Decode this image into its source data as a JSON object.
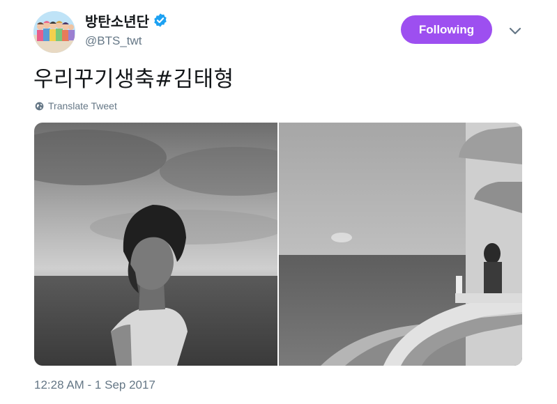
{
  "user": {
    "display_name": "방탄소년단",
    "handle": "@BTS_twt",
    "verified_icon": "verified-badge-icon",
    "avatar_icon": "avatar"
  },
  "follow_button": {
    "label": "Following",
    "color": "#9d4ff0"
  },
  "menu_icon": "chevron-down-icon",
  "tweet": {
    "text": "우리꾸기생축#김태형",
    "translate_label": "Translate Tweet",
    "translate_icon": "globe-icon",
    "timestamp": "12:28 AM - 1 Sep 2017"
  },
  "colors": {
    "text": "#14171a",
    "secondary": "#657786",
    "verified": "#1da1f2"
  }
}
